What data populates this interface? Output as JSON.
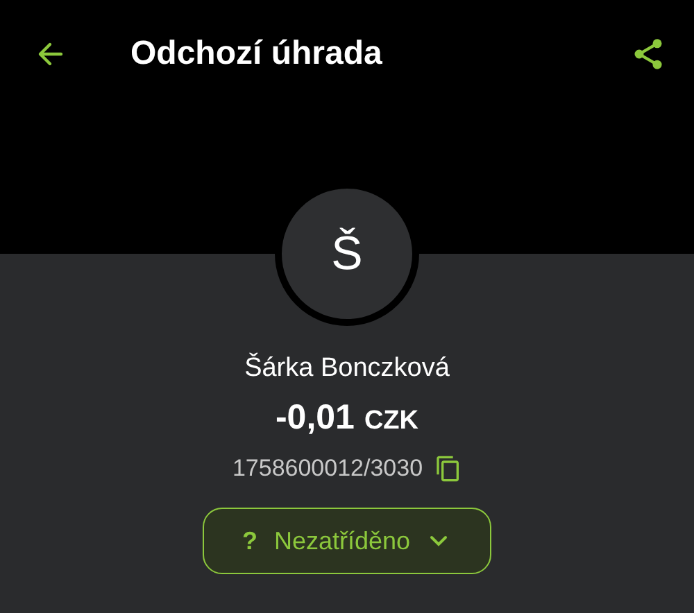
{
  "header": {
    "title": "Odchozí úhrada"
  },
  "avatar": {
    "letter": "Š"
  },
  "payee": {
    "name": "Šárka Bonczková",
    "amount": "-0,01",
    "currency": "CZK",
    "account": "1758600012/3030"
  },
  "category": {
    "icon": "?",
    "label": "Nezatříděno"
  }
}
